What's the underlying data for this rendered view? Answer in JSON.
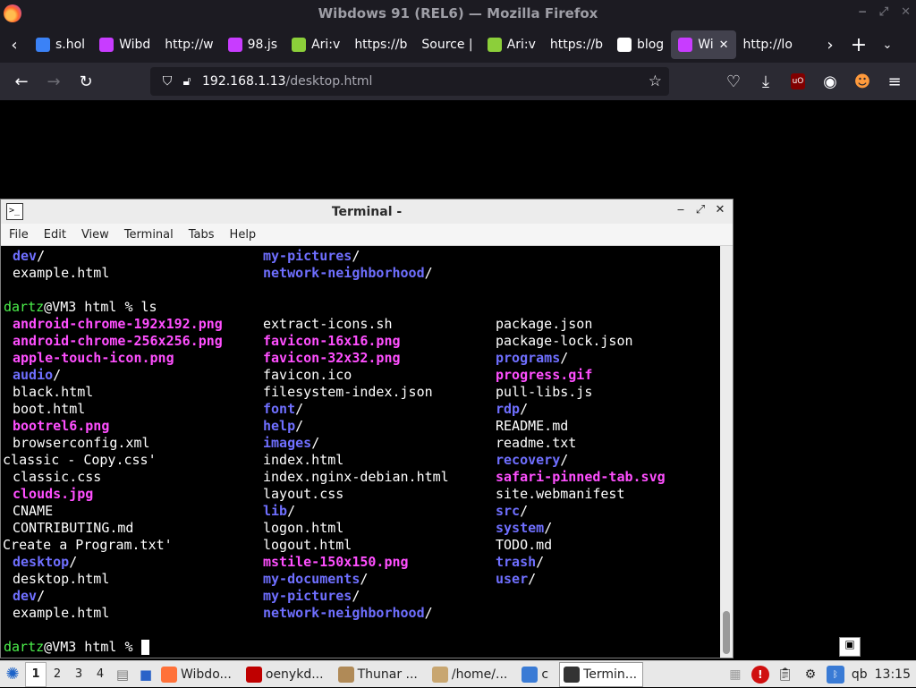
{
  "window": {
    "title": "Wibdows 91 (REL6) — Mozilla Firefox"
  },
  "tabs": [
    {
      "label": "s.hol",
      "icon": "site-icon",
      "color": "#3b82f6"
    },
    {
      "label": "Wibd",
      "icon": "wibdows-icon",
      "color": "#c83cff"
    },
    {
      "label": "http://w",
      "icon": "",
      "color": ""
    },
    {
      "label": "98.js",
      "icon": "wibdows-icon",
      "color": "#c83cff"
    },
    {
      "label": "Ari:v",
      "icon": "ari-icon",
      "color": "#8ccf3a"
    },
    {
      "label": "https://b",
      "icon": "",
      "color": ""
    },
    {
      "label": "Source |",
      "icon": "",
      "color": ""
    },
    {
      "label": "Ari:v",
      "icon": "ari-icon",
      "color": "#8ccf3a"
    },
    {
      "label": "https://b",
      "icon": "",
      "color": ""
    },
    {
      "label": "blog",
      "icon": "github-icon",
      "color": "#ffffff"
    },
    {
      "label": "Wi",
      "icon": "wibdows-icon",
      "color": "#c83cff",
      "active": true
    },
    {
      "label": "http://lo",
      "icon": "",
      "color": ""
    }
  ],
  "url": {
    "host": "192.168.1.13",
    "path": "/desktop.html"
  },
  "terminal": {
    "title": "Terminal -",
    "menu": [
      "File",
      "Edit",
      "View",
      "Terminal",
      "Tabs",
      "Help"
    ],
    "lines": [
      {
        "c1": {
          "t": "dev",
          "k": "dir",
          "s": "/"
        },
        "c2": {
          "t": "my-pictures",
          "k": "dir",
          "s": "/"
        }
      },
      {
        "c1": {
          "t": "example.html",
          "k": "plain",
          "s": ""
        },
        "c2": {
          "t": "network-neighborhood",
          "k": "dir",
          "s": "/"
        }
      },
      {
        "blank": true
      },
      {
        "prompt": {
          "user": "dartz",
          "rest": "@VM3 html % ls"
        }
      },
      {
        "c1": {
          "t": "android-chrome-192x192.png",
          "k": "img",
          "s": ""
        },
        "c2": {
          "t": "extract-icons.sh",
          "k": "plain",
          "s": ""
        },
        "c3": {
          "t": "package.json",
          "k": "plain",
          "s": ""
        }
      },
      {
        "c1": {
          "t": "android-chrome-256x256.png",
          "k": "img",
          "s": ""
        },
        "c2": {
          "t": "favicon-16x16.png",
          "k": "img",
          "s": ""
        },
        "c3": {
          "t": "package-lock.json",
          "k": "plain",
          "s": ""
        }
      },
      {
        "c1": {
          "t": "apple-touch-icon.png",
          "k": "img",
          "s": ""
        },
        "c2": {
          "t": "favicon-32x32.png",
          "k": "img",
          "s": ""
        },
        "c3": {
          "t": "programs",
          "k": "dir",
          "s": "/"
        }
      },
      {
        "c1": {
          "t": "audio",
          "k": "dir",
          "s": "/"
        },
        "c2": {
          "t": "favicon.ico",
          "k": "plain",
          "s": ""
        },
        "c3": {
          "t": "progress.gif",
          "k": "img",
          "s": ""
        }
      },
      {
        "c1": {
          "t": "black.html",
          "k": "plain",
          "s": ""
        },
        "c2": {
          "t": "filesystem-index.json",
          "k": "plain",
          "s": ""
        },
        "c3": {
          "t": "pull-libs.js",
          "k": "plain",
          "s": ""
        }
      },
      {
        "c1": {
          "t": "boot.html",
          "k": "plain",
          "s": ""
        },
        "c2": {
          "t": "font",
          "k": "dir",
          "s": "/"
        },
        "c3": {
          "t": "rdp",
          "k": "dir",
          "s": "/"
        }
      },
      {
        "c1": {
          "t": "bootrel6.png",
          "k": "img",
          "s": ""
        },
        "c2": {
          "t": "help",
          "k": "dir",
          "s": "/"
        },
        "c3": {
          "t": "README.md",
          "k": "plain",
          "s": ""
        }
      },
      {
        "c1": {
          "t": "browserconfig.xml",
          "k": "plain",
          "s": ""
        },
        "c2": {
          "t": "images",
          "k": "dir",
          "s": "/"
        },
        "c3": {
          "t": "readme.txt",
          "k": "plain",
          "s": ""
        }
      },
      {
        "c1": {
          "t": "'classic - Copy.css'",
          "k": "plain",
          "s": "",
          "q": true
        },
        "c2": {
          "t": "index.html",
          "k": "plain",
          "s": ""
        },
        "c3": {
          "t": "recovery",
          "k": "dir",
          "s": "/"
        }
      },
      {
        "c1": {
          "t": "classic.css",
          "k": "plain",
          "s": ""
        },
        "c2": {
          "t": "index.nginx-debian.html",
          "k": "plain",
          "s": ""
        },
        "c3": {
          "t": "safari-pinned-tab.svg",
          "k": "img",
          "s": ""
        }
      },
      {
        "c1": {
          "t": "clouds.jpg",
          "k": "img",
          "s": ""
        },
        "c2": {
          "t": "layout.css",
          "k": "plain",
          "s": ""
        },
        "c3": {
          "t": "site.webmanifest",
          "k": "plain",
          "s": ""
        }
      },
      {
        "c1": {
          "t": "CNAME",
          "k": "plain",
          "s": ""
        },
        "c2": {
          "t": "lib",
          "k": "dir",
          "s": "/"
        },
        "c3": {
          "t": "src",
          "k": "dir",
          "s": "/"
        }
      },
      {
        "c1": {
          "t": "CONTRIBUTING.md",
          "k": "plain",
          "s": ""
        },
        "c2": {
          "t": "logon.html",
          "k": "plain",
          "s": ""
        },
        "c3": {
          "t": "system",
          "k": "dir",
          "s": "/"
        }
      },
      {
        "c1": {
          "t": "'Create a Program.txt'",
          "k": "plain",
          "s": "",
          "q": true
        },
        "c2": {
          "t": "logout.html",
          "k": "plain",
          "s": ""
        },
        "c3": {
          "t": "TODO.md",
          "k": "plain",
          "s": ""
        }
      },
      {
        "c1": {
          "t": "desktop",
          "k": "dir",
          "s": "/"
        },
        "c2": {
          "t": "mstile-150x150.png",
          "k": "img",
          "s": ""
        },
        "c3": {
          "t": "trash",
          "k": "dir",
          "s": "/"
        }
      },
      {
        "c1": {
          "t": "desktop.html",
          "k": "plain",
          "s": ""
        },
        "c2": {
          "t": "my-documents",
          "k": "dir",
          "s": "/"
        },
        "c3": {
          "t": "user",
          "k": "dir",
          "s": "/"
        }
      },
      {
        "c1": {
          "t": "dev",
          "k": "dir",
          "s": "/"
        },
        "c2": {
          "t": "my-pictures",
          "k": "dir",
          "s": "/"
        }
      },
      {
        "c1": {
          "t": "example.html",
          "k": "plain",
          "s": ""
        },
        "c2": {
          "t": "network-neighborhood",
          "k": "dir",
          "s": "/"
        }
      },
      {
        "blank": true
      },
      {
        "prompt": {
          "user": "dartz",
          "rest": "@VM3 html % "
        },
        "cursor": true
      }
    ]
  },
  "taskbar": {
    "workspaces": [
      "1",
      "2",
      "3",
      "4"
    ],
    "tasks": [
      {
        "label": "Wibdo...",
        "icon": "firefox-icon",
        "color": "#ff7139"
      },
      {
        "label": "oenykd...",
        "icon": "filezilla-icon",
        "color": "#bf0000"
      },
      {
        "label": "Thunar ...",
        "icon": "thunar-icon",
        "color": "#b08a57"
      },
      {
        "label": "/home/...",
        "icon": "archive-icon",
        "color": "#c8a670"
      },
      {
        "label": "c",
        "icon": "folder-icon",
        "color": "#3a7bd5"
      },
      {
        "label": "Termin...",
        "icon": "terminal-icon",
        "color": "#333333",
        "active": true
      }
    ],
    "tray_text": "qb",
    "clock": "13:15"
  }
}
